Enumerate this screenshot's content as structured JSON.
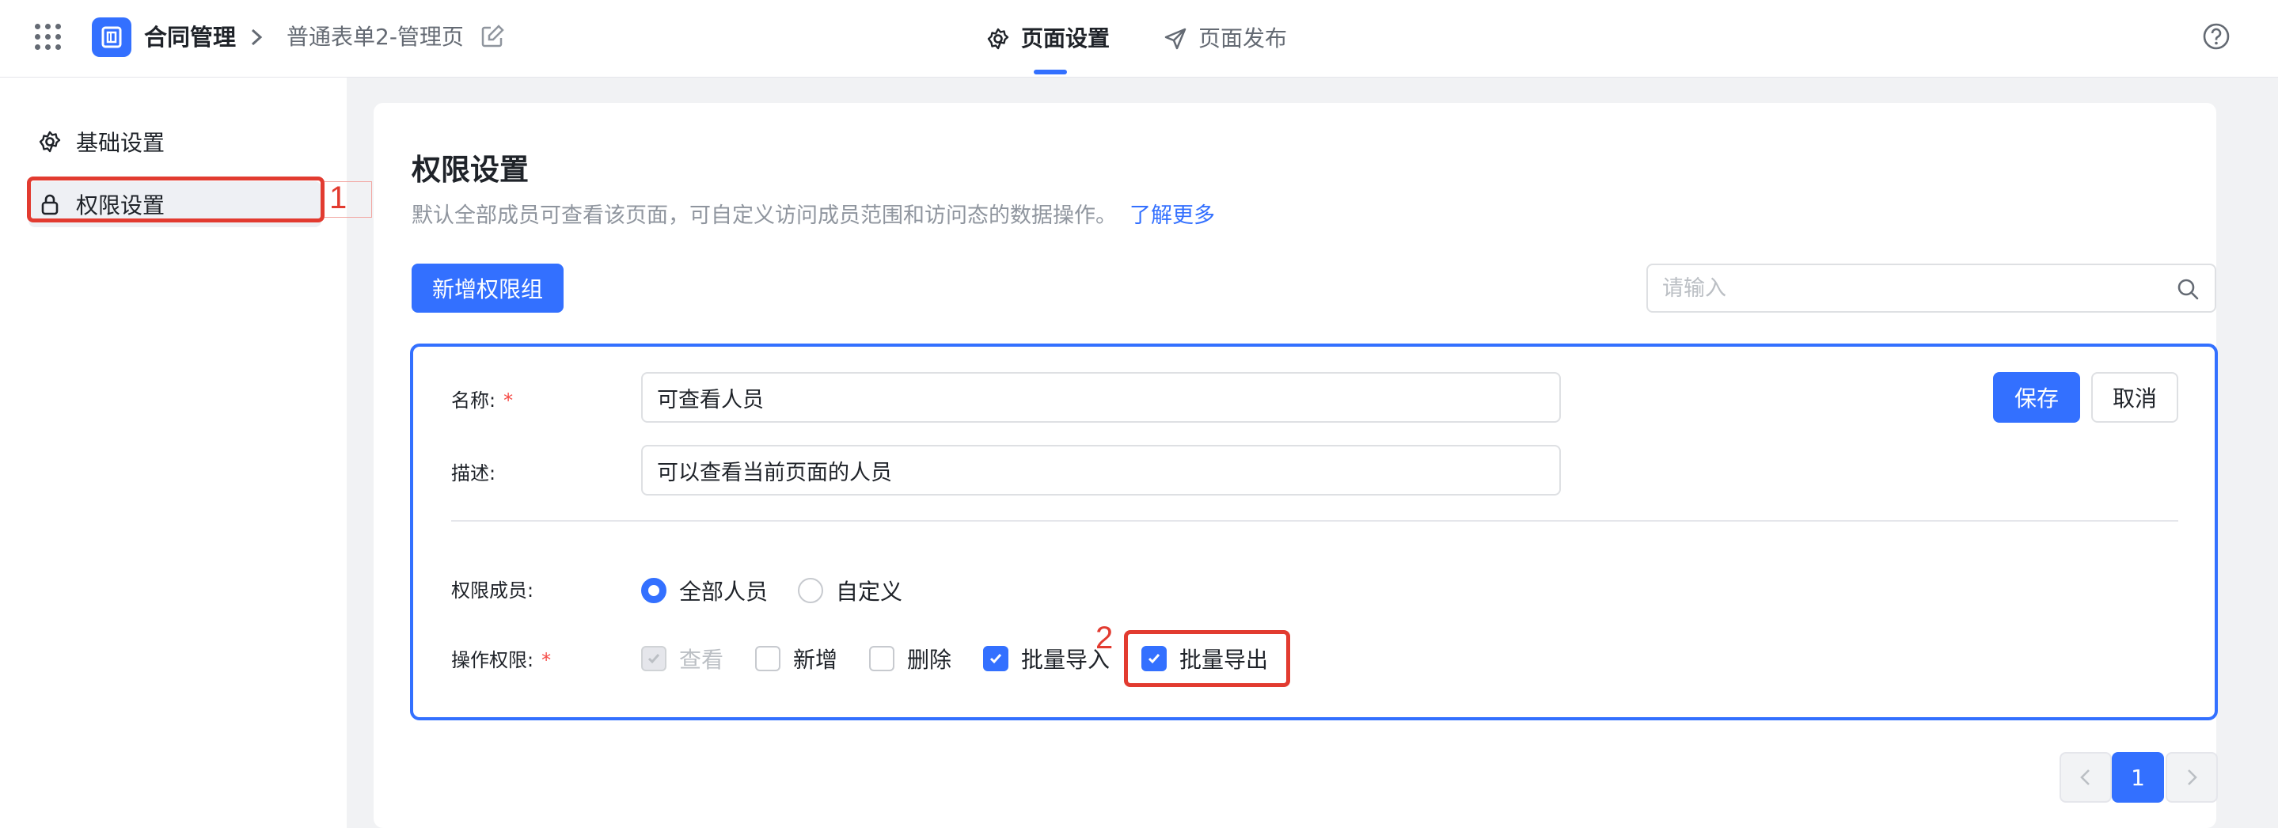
{
  "header": {
    "app_name": "合同管理",
    "page_name": "普通表单2-管理页",
    "tabs": [
      {
        "label": "页面设置",
        "active": true
      },
      {
        "label": "页面发布",
        "active": false
      }
    ],
    "icons": [
      "apps-grid-icon",
      "app-logo-icon",
      "chevron-right-icon",
      "edit-icon",
      "gear-icon",
      "send-icon",
      "help-icon"
    ]
  },
  "sidebar": {
    "items": [
      {
        "label": "基础设置",
        "icon": "gear-icon",
        "active": false
      },
      {
        "label": "权限设置",
        "icon": "lock-icon",
        "active": true
      }
    ]
  },
  "main": {
    "title": "权限设置",
    "description": "默认全部成员可查看该页面，可自定义访问成员范围和访问态的数据操作。",
    "learn_more": "了解更多",
    "add_group_button": "新增权限组",
    "search_placeholder": "请输入"
  },
  "group_form": {
    "name_label": "名称:",
    "name_value": "可查看人员",
    "desc_label": "描述:",
    "desc_value": "可以查看当前页面的人员",
    "required_mark": "*",
    "save_button": "保存",
    "cancel_button": "取消",
    "members_label": "权限成员:",
    "members_options": [
      {
        "label": "全部人员",
        "selected": true
      },
      {
        "label": "自定义",
        "selected": false
      }
    ],
    "ops_label": "操作权限:",
    "ops": [
      {
        "label": "查看",
        "checked": true,
        "disabled": true
      },
      {
        "label": "新增",
        "checked": false,
        "disabled": false
      },
      {
        "label": "删除",
        "checked": false,
        "disabled": false
      },
      {
        "label": "批量导入",
        "checked": true,
        "disabled": false
      },
      {
        "label": "批量导出",
        "checked": true,
        "disabled": false
      }
    ]
  },
  "pagination": {
    "current_page": "1"
  },
  "annotations": {
    "step1": "1",
    "step2": "2"
  },
  "colors": {
    "primary": "#3370ff",
    "annotation": "#e23b30",
    "required": "#f54a45"
  }
}
